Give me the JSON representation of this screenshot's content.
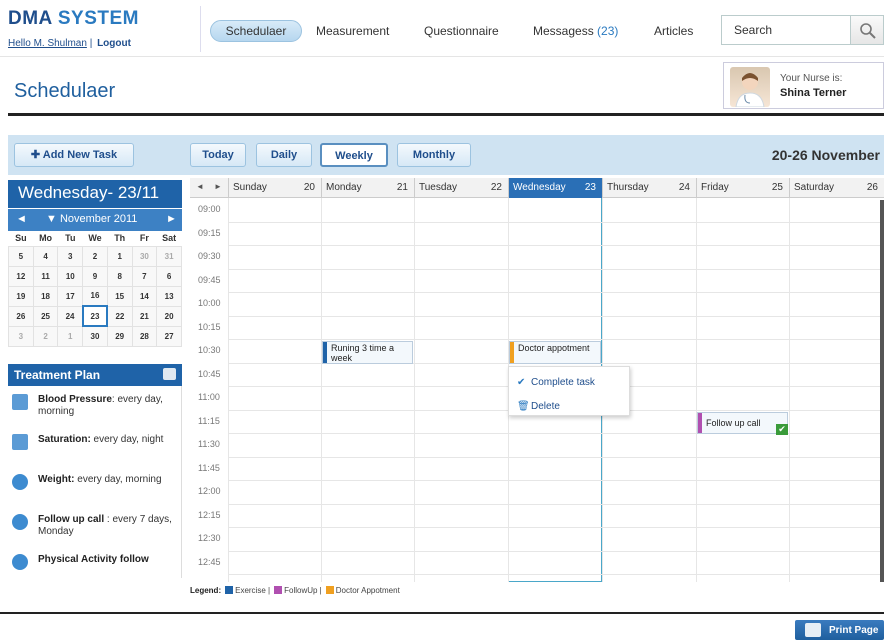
{
  "app": {
    "title_a": "DMA",
    "title_b": "SYSTEM",
    "greeting": "Hello M. Shulman",
    "logout": "Logout"
  },
  "nav": {
    "items": [
      "Schedulaer",
      "Measurement",
      "Questionnaire",
      "Messagess",
      "Articles"
    ],
    "messages_count": "(23)"
  },
  "search": {
    "value": "Search"
  },
  "page": {
    "title": "Schedulaer"
  },
  "nurse": {
    "label": "Your Nurse is:",
    "name": "Shina Terner"
  },
  "toolbar": {
    "add_task": "Add New Task",
    "today": "Today",
    "daily": "Daily",
    "weekly": "Weekly",
    "monthly": "Monthly",
    "selected_view": "Weekly",
    "week_range": "20-26 November"
  },
  "mini_calendar": {
    "heading": "Wednesday- 23/11",
    "month": "November 2011",
    "weekdays": [
      "Su",
      "Mo",
      "Tu",
      "We",
      "Th",
      "Fr",
      "Sat"
    ],
    "rows": [
      [
        "5",
        "4",
        "3",
        "2",
        "1",
        "30",
        "31"
      ],
      [
        "12",
        "11",
        "10",
        "9",
        "8",
        "7",
        "6"
      ],
      [
        "19",
        "18",
        "17",
        "16",
        "15",
        "14",
        "13"
      ],
      [
        "26",
        "25",
        "24",
        "23",
        "22",
        "21",
        "20"
      ],
      [
        "3",
        "2",
        "1",
        "30",
        "29",
        "28",
        "27"
      ]
    ],
    "selected": "23"
  },
  "treatment_plan": {
    "title": "Treatment Plan",
    "items": [
      {
        "name": "Blood Pressure",
        "detail": ": every day, morning",
        "icon": "monitor-icon"
      },
      {
        "name": "Saturation:",
        "detail": " every day, night",
        "icon": "monitor-icon"
      },
      {
        "name": "Weight:",
        "detail": " every day, morning",
        "icon": "phone-icon"
      },
      {
        "name": "Follow up call",
        "detail": " : every 7 days, Monday",
        "icon": "phone-icon"
      },
      {
        "name": "Physical Activity follow",
        "detail": "",
        "icon": "phone-icon"
      }
    ]
  },
  "schedule": {
    "days": [
      {
        "name": "Sunday",
        "num": "20"
      },
      {
        "name": "Monday",
        "num": "21"
      },
      {
        "name": "Tuesday",
        "num": "22"
      },
      {
        "name": "Wednesday",
        "num": "23"
      },
      {
        "name": "Thursday",
        "num": "24"
      },
      {
        "name": "Friday",
        "num": "25"
      },
      {
        "name": "Saturday",
        "num": "26"
      }
    ],
    "times": [
      "09:00",
      "09:15",
      "09:30",
      "09:45",
      "10:00",
      "10:15",
      "10:30",
      "10:45",
      "11:00",
      "11:15",
      "11:30",
      "11:45",
      "12:00",
      "12:15",
      "12:30",
      "12:45"
    ],
    "events": [
      {
        "title": "Runing 3 time a week",
        "day": "Monday",
        "time": "10:30",
        "category": "Exercise"
      },
      {
        "title": "Doctor appotment",
        "day": "Wednesday",
        "time": "10:30",
        "category": "Doctor Appotment"
      },
      {
        "title": "Follow up call",
        "day": "Friday",
        "time": "11:15",
        "category": "FollowUp",
        "completed": true
      }
    ]
  },
  "context_menu": {
    "complete": "Complete task",
    "delete": "Delete"
  },
  "legend": {
    "label": "Legend:",
    "items": [
      {
        "name": "Exercise",
        "color": "#1f63a8"
      },
      {
        "name": "FollowUp",
        "color": "#b04fb0"
      },
      {
        "name": "Doctor Appotment",
        "color": "#f0a020"
      }
    ]
  },
  "footer": {
    "print": "Print Page"
  },
  "colors": {
    "brand": "#1f63a8",
    "accent": "#2a7ac0",
    "exercise": "#1f63a8",
    "followup": "#b04fb0",
    "doctor": "#f0a020"
  }
}
